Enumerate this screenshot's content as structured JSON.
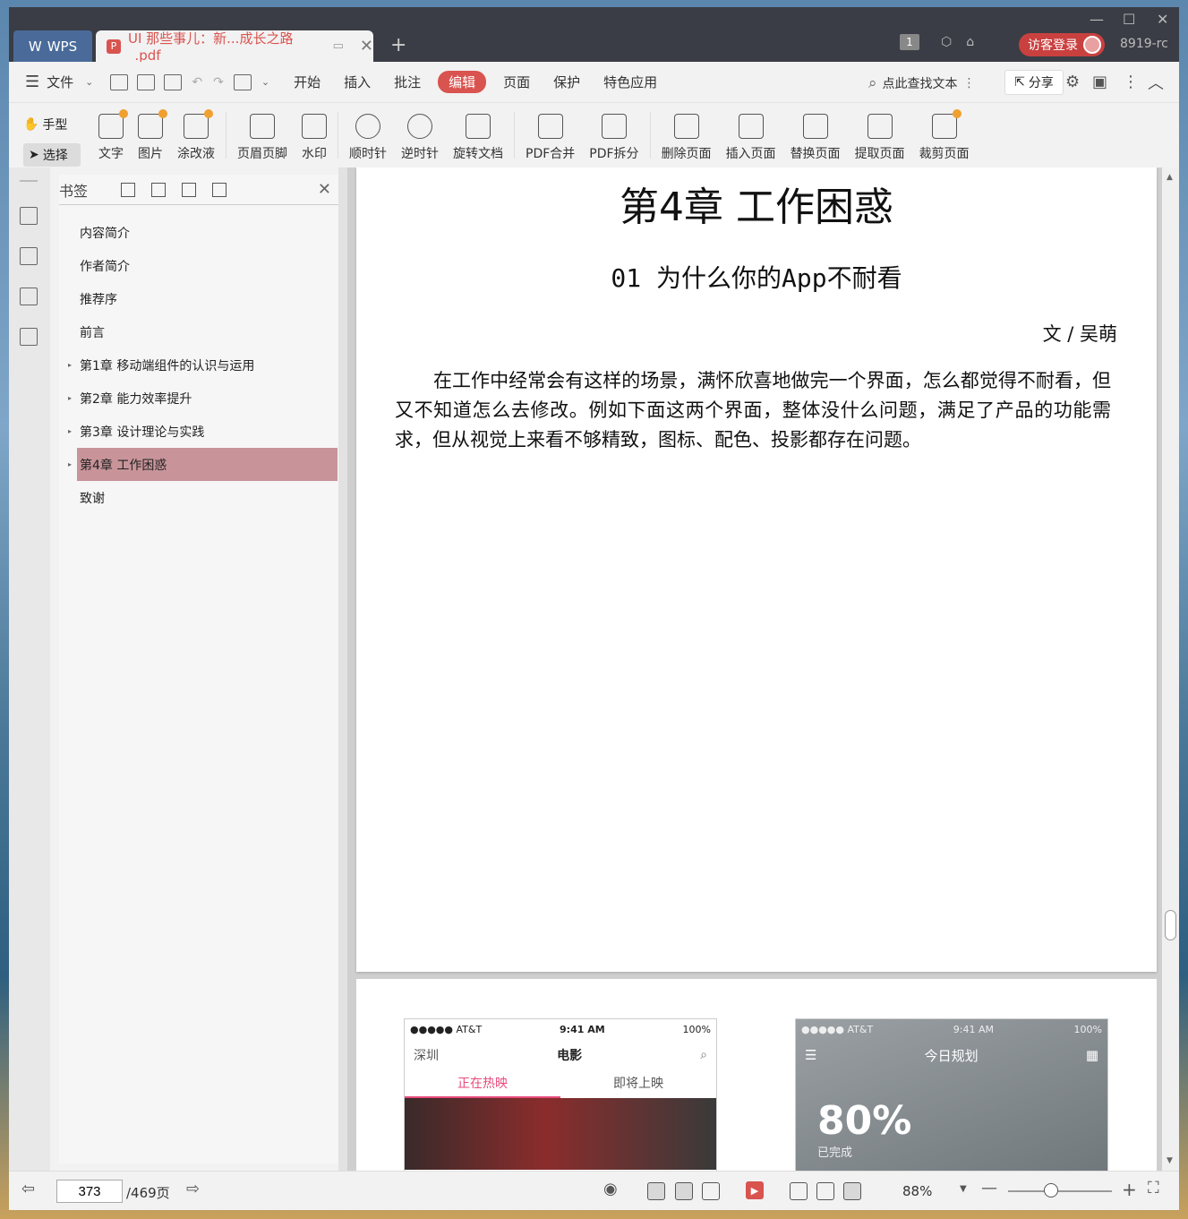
{
  "titlebar": {
    "wps_tab": "WPS",
    "doc_tab": "UI 那些事儿：新...成长之路_.pdf",
    "page_badge": "1",
    "login": "访客登录",
    "user_code": "8919-rc"
  },
  "menubar": {
    "file": "文件",
    "items": [
      "开始",
      "插入",
      "批注",
      "编辑",
      "页面",
      "保护",
      "特色应用"
    ],
    "active": "编辑",
    "search": "点此查找文本",
    "share": "分享"
  },
  "toolbar": {
    "hand": "手型",
    "select": "选择",
    "tools": [
      "文字",
      "图片",
      "涂改液",
      "页眉页脚",
      "水印",
      "顺时针",
      "逆时针",
      "旋转文档",
      "PDF合并",
      "PDF拆分",
      "删除页面",
      "插入页面",
      "替换页面",
      "提取页面",
      "裁剪页面"
    ]
  },
  "bookmarks": {
    "title": "书签",
    "items": [
      {
        "label": "内容简介",
        "expandable": false
      },
      {
        "label": "作者简介",
        "expandable": false
      },
      {
        "label": "推荐序",
        "expandable": false
      },
      {
        "label": "前言",
        "expandable": false
      },
      {
        "label": "第1章 移动端组件的认识与运用",
        "expandable": true
      },
      {
        "label": "第2章 能力效率提升",
        "expandable": true
      },
      {
        "label": "第3章 设计理论与实践",
        "expandable": true
      },
      {
        "label": "第4章 工作困惑",
        "expandable": true,
        "selected": true
      },
      {
        "label": "致谢",
        "expandable": false
      }
    ]
  },
  "document": {
    "chapter_title": "第4章 工作困惑",
    "section_title": "01 为什么你的App不耐看",
    "author": "文 / 吴萌",
    "paragraph": "在工作中经常会有这样的场景，满怀欣喜地做完一个界面，怎么都觉得不耐看，但又不知道怎么去修改。例如下面这两个界面，整体没什么问题，满足了产品的功能需求，但从视觉上来看不够精致，图标、配色、投影都存在问题。",
    "phone1": {
      "carrier": "●●●●● AT&T",
      "time": "9:41 AM",
      "battery": "100%",
      "city": "深圳",
      "title": "电影",
      "tab_active": "正在热映",
      "tab_other": "即将上映"
    },
    "phone2": {
      "carrier": "●●●●● AT&T",
      "time": "9:41 AM",
      "battery": "100%",
      "title": "今日规划",
      "percent": "80%",
      "done": "已完成"
    }
  },
  "statusbar": {
    "page": "373",
    "total": "/469页",
    "zoom": "88%"
  }
}
